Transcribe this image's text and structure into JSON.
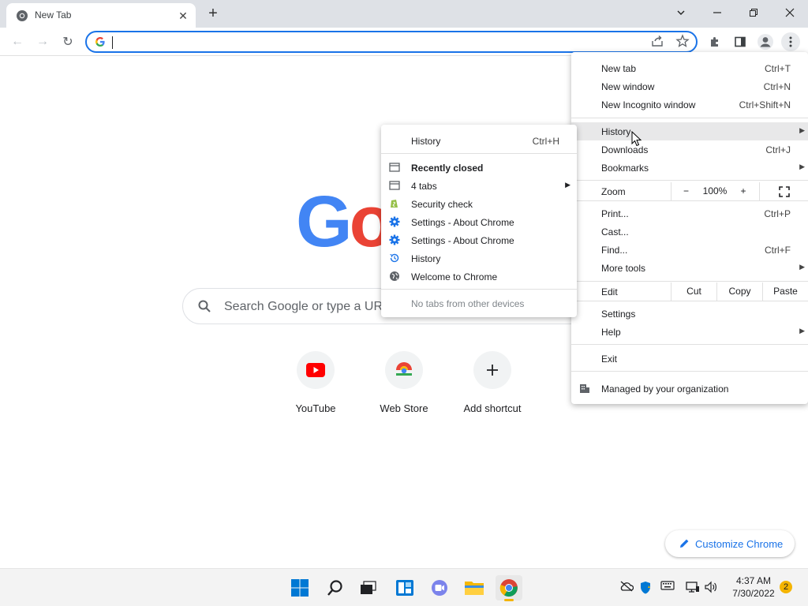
{
  "tab": {
    "title": "New Tab",
    "close": "✕"
  },
  "window": {
    "new_tab": "+",
    "dropdown": "⌄",
    "minimize": "—",
    "restore": "❐",
    "close": "✕"
  },
  "toolbar": {
    "back": "←",
    "forward": "→",
    "reload": "↻",
    "omnibox_value": ""
  },
  "content": {
    "search_placeholder": "Search Google or type a URL",
    "shortcuts": [
      {
        "label": "YouTube",
        "icon": "youtube-icon"
      },
      {
        "label": "Web Store",
        "icon": "webstore-icon"
      },
      {
        "label": "Add shortcut",
        "icon": "plus-icon"
      }
    ],
    "customize": "Customize Chrome"
  },
  "main_menu": {
    "new_tab": {
      "label": "New tab",
      "shortcut": "Ctrl+T"
    },
    "new_window": {
      "label": "New window",
      "shortcut": "Ctrl+N"
    },
    "new_incognito": {
      "label": "New Incognito window",
      "shortcut": "Ctrl+Shift+N"
    },
    "history": {
      "label": "History"
    },
    "downloads": {
      "label": "Downloads",
      "shortcut": "Ctrl+J"
    },
    "bookmarks": {
      "label": "Bookmarks"
    },
    "zoom": {
      "label": "Zoom",
      "minus": "−",
      "value": "100%",
      "plus": "+"
    },
    "print": {
      "label": "Print...",
      "shortcut": "Ctrl+P"
    },
    "cast": {
      "label": "Cast..."
    },
    "find": {
      "label": "Find...",
      "shortcut": "Ctrl+F"
    },
    "more_tools": {
      "label": "More tools"
    },
    "edit": {
      "label": "Edit",
      "cut": "Cut",
      "copy": "Copy",
      "paste": "Paste"
    },
    "settings": {
      "label": "Settings"
    },
    "help": {
      "label": "Help"
    },
    "exit": {
      "label": "Exit"
    },
    "managed": {
      "label": "Managed by your organization"
    }
  },
  "history_menu": {
    "history": {
      "label": "History",
      "shortcut": "Ctrl+H"
    },
    "recently_closed": "Recently closed",
    "items": [
      {
        "label": "4 tabs",
        "icon": "tab-window-icon",
        "has_arrow": true
      },
      {
        "label": "Security check",
        "icon": "shopify-icon"
      },
      {
        "label": "Settings - About Chrome",
        "icon": "settings-gear-icon"
      },
      {
        "label": "Settings - About Chrome",
        "icon": "settings-gear-icon"
      },
      {
        "label": "History",
        "icon": "history-icon"
      },
      {
        "label": "Welcome to Chrome",
        "icon": "globe-icon"
      }
    ],
    "no_tabs": "No tabs from other devices"
  },
  "taskbar": {
    "time": "4:37 AM",
    "date": "7/30/2022",
    "notifications": "2"
  },
  "colors": {
    "accent": "#1a73e8",
    "google_blue": "#4285f4",
    "google_red": "#ea4335",
    "google_yellow": "#fbbc05",
    "google_green": "#34a853"
  }
}
